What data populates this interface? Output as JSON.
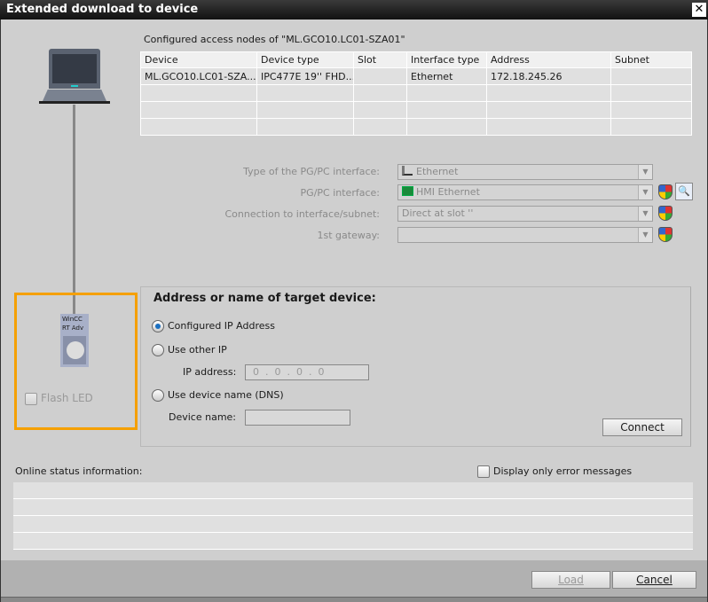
{
  "window": {
    "title": "Extended download to device",
    "close": "✕"
  },
  "nodes": {
    "title": "Configured access nodes of \"ML.GCO10.LC01-SZA01\"",
    "columns": [
      "Device",
      "Device type",
      "Slot",
      "Interface type",
      "Address",
      "Subnet"
    ],
    "rows": [
      [
        "ML.GCO10.LC01-SZA...",
        "IPC477E 19'' FHD...",
        "",
        "Ethernet",
        "172.18.245.26",
        ""
      ]
    ]
  },
  "interface": {
    "type_label": "Type of the PG/PC interface:",
    "type_value": "Ethernet",
    "pgpc_label": "PG/PC interface:",
    "pgpc_value": "HMI Ethernet",
    "conn_label": "Connection to interface/subnet:",
    "conn_value": "Direct at slot ''",
    "gw_label": "1st gateway:",
    "gw_value": ""
  },
  "device": {
    "label_line1": "WinCC",
    "label_line2": "RT Adv",
    "flash_led": "Flash LED"
  },
  "target": {
    "title": "Address or name of target device:",
    "opt_configured": "Configured IP Address",
    "opt_other": "Use other IP",
    "ip_label": "IP address:",
    "ip_value": "0  .  0  .  0  .  0",
    "opt_dns": "Use device name (DNS)",
    "name_label": "Device name:",
    "name_value": "",
    "connect": "Connect",
    "selected": "configured"
  },
  "status": {
    "label": "Online status information:",
    "errors_only": "Display only error messages"
  },
  "footer": {
    "load": "Load",
    "cancel": "Cancel"
  }
}
